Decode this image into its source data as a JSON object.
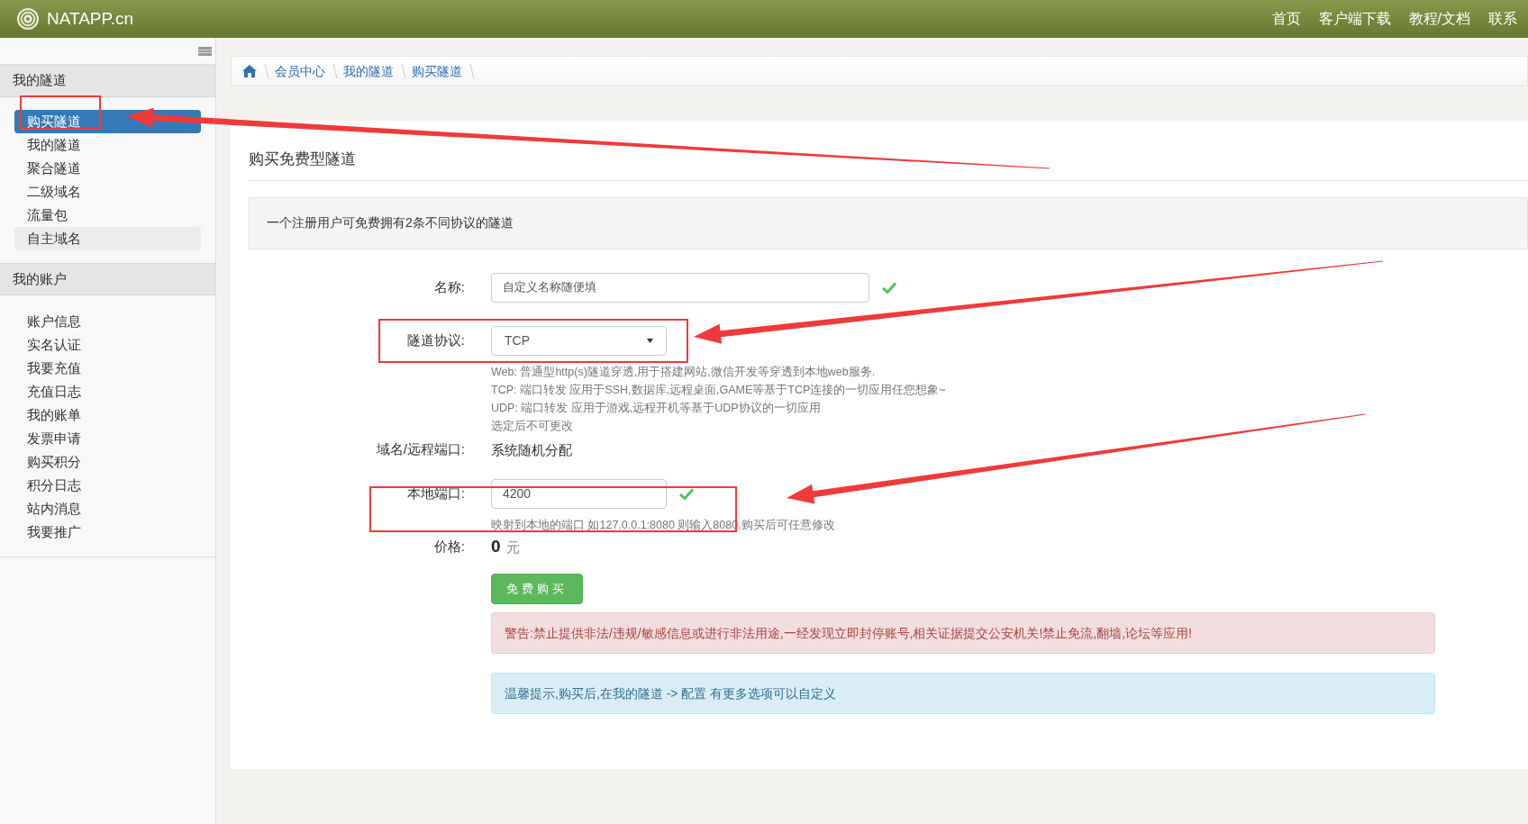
{
  "brand": "NATAPP.cn",
  "nav": [
    "首页",
    "客户端下载",
    "教程/文档",
    "联系"
  ],
  "sidebar": {
    "sections": [
      {
        "title": "我的隧道",
        "items": [
          {
            "label": "购买隧道",
            "selected": true,
            "hovered": false
          },
          {
            "label": "我的隧道",
            "selected": false,
            "hovered": false
          },
          {
            "label": "聚合隧道",
            "selected": false,
            "hovered": false
          },
          {
            "label": "二级域名",
            "selected": false,
            "hovered": false
          },
          {
            "label": "流量包",
            "selected": false,
            "hovered": false
          },
          {
            "label": "自主域名",
            "selected": false,
            "hovered": true
          }
        ]
      },
      {
        "title": "我的账户",
        "items": [
          {
            "label": "账户信息",
            "selected": false,
            "hovered": false
          },
          {
            "label": "实名认证",
            "selected": false,
            "hovered": false
          },
          {
            "label": "我要充值",
            "selected": false,
            "hovered": false
          },
          {
            "label": "充值日志",
            "selected": false,
            "hovered": false
          },
          {
            "label": "我的账单",
            "selected": false,
            "hovered": false
          },
          {
            "label": "发票申请",
            "selected": false,
            "hovered": false
          },
          {
            "label": "购买积分",
            "selected": false,
            "hovered": false
          },
          {
            "label": "积分日志",
            "selected": false,
            "hovered": false
          },
          {
            "label": "站内消息",
            "selected": false,
            "hovered": false
          },
          {
            "label": "我要推广",
            "selected": false,
            "hovered": false
          }
        ]
      }
    ]
  },
  "breadcrumb": [
    "会员中心",
    "我的隧道",
    "购买隧道"
  ],
  "page_title": "购买免费型隧道",
  "notice": "一个注册用户可免费拥有2条不同协议的隧道",
  "form": {
    "name": {
      "label": "名称:",
      "value": "自定义名称随便填",
      "valid": true
    },
    "protocol": {
      "label": "隧道协议:",
      "value": "TCP",
      "help": [
        "Web: 普通型http(s)隧道穿透,用于搭建网站,微信开发等穿透到本地web服务.",
        "TCP: 端口转发 应用于SSH,数据库,远程桌面,GAME等基于TCP连接的一切应用任您想象~",
        "UDP: 端口转发 应用于游戏,远程开机等基于UDP协议的一切应用",
        "选定后不可更改"
      ]
    },
    "domain": {
      "label": "域名/远程端口:",
      "value": "系统随机分配"
    },
    "local_port": {
      "label": "本地端口:",
      "value": "4200",
      "valid": true,
      "help": "映射到本地的端口 如127.0.0.1:8080 则输入8080.购买后可任意修改"
    },
    "price": {
      "label": "价格:",
      "amount": "0",
      "unit": "元"
    },
    "submit": "免费购买"
  },
  "alerts": [
    {
      "kind": "danger",
      "text": "警告:禁止提供非法/违规/敏感信息或进行非法用途,一经发现立即封停账号,相关证据提交公安机关!禁止免流,翻墙,论坛等应用!"
    },
    {
      "kind": "info",
      "text": "温馨提示,购买后,在我的隧道 -> 配置 有更多选项可以自定义"
    }
  ]
}
